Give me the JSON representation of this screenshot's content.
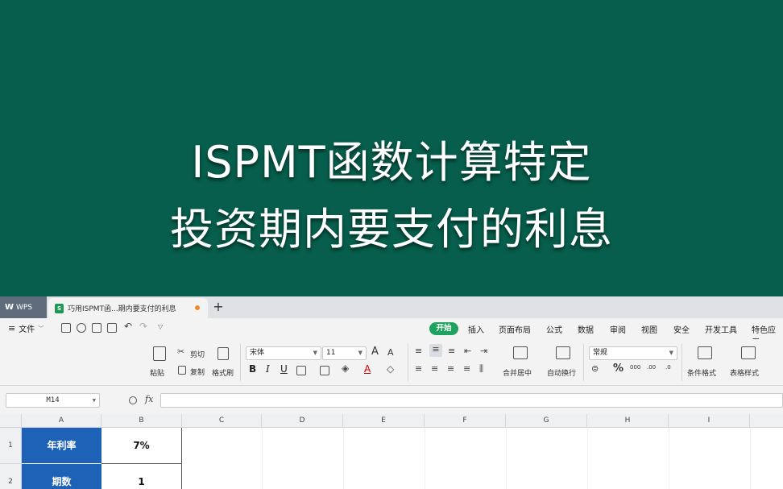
{
  "banner": {
    "line1": "ISPMT函数计算特定",
    "line2": "投资期内要支付的利息"
  },
  "tabs": {
    "home_label": "WPS",
    "doc_title": "巧用ISPMT函...期内要支付的利息",
    "add_label": "+"
  },
  "menu": {
    "file_label": "文件",
    "tabs": [
      "开始",
      "插入",
      "页面布局",
      "公式",
      "数据",
      "审阅",
      "视图",
      "安全",
      "开发工具",
      "特色应用"
    ]
  },
  "ribbon": {
    "paste_label": "粘贴",
    "cut_label": "剪切",
    "copy_label": "复制",
    "format_painter_label": "格式刷",
    "font_name": "宋体",
    "font_size": "11",
    "grow_font": "A",
    "shrink_font": "A",
    "bold": "B",
    "italic": "I",
    "underline": "U",
    "font_color_glyph": "A",
    "merge_label": "合并居中",
    "wrap_label": "自动换行",
    "number_format": "常规",
    "percent_glyph": "%",
    "thousands_glyph": "000",
    "inc_decimal_glyph": ".00",
    "dec_decimal_glyph": ".0",
    "cond_format_label": "条件格式",
    "table_style_label": "表格样式"
  },
  "formula_bar": {
    "name_box": "M14",
    "fx_label": "fx",
    "formula": ""
  },
  "grid": {
    "columns": [
      "A",
      "B",
      "C",
      "D",
      "E",
      "F",
      "G",
      "H",
      "I"
    ],
    "rows": [
      {
        "num": "1",
        "label": "年利率",
        "value": "7%"
      },
      {
        "num": "2",
        "label": "期数",
        "value": "1"
      }
    ]
  },
  "colors": {
    "banner_bg": "#075e4c",
    "accent_green": "#1ea260",
    "header_cell_blue": "#1d62b7"
  }
}
